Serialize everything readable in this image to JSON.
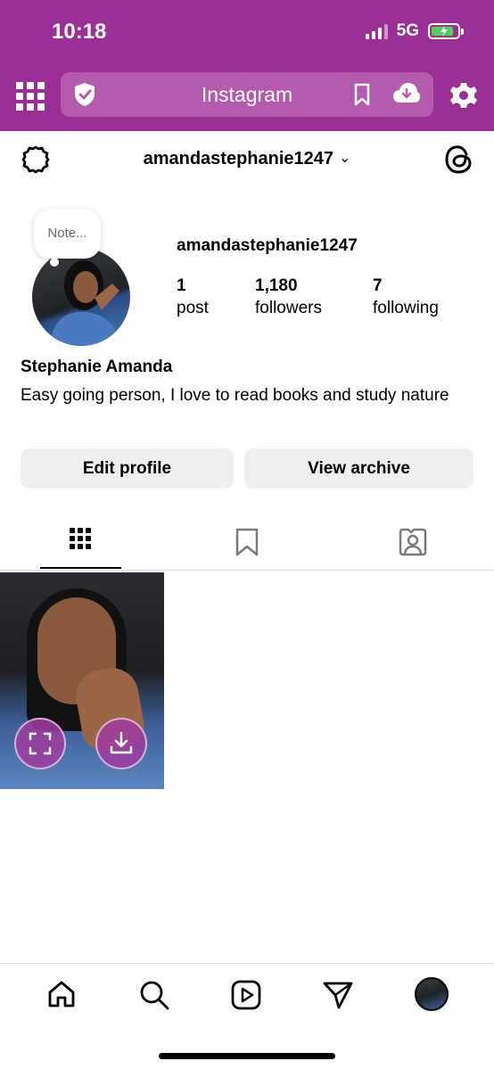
{
  "status_bar": {
    "time": "10:18",
    "network": "5G",
    "battery_charging": true,
    "icons": [
      "signal-icon",
      "battery-icon"
    ]
  },
  "browser_bar": {
    "title": "Instagram",
    "background_color": "#9b2f95",
    "icons": [
      "grid-menu-icon",
      "shield-icon",
      "bookmark-icon",
      "cloud-download-icon",
      "gear-icon"
    ]
  },
  "profile_header": {
    "username": "amandastephanie1247",
    "icons": [
      "settings-icon",
      "chevron-down-icon",
      "threads-icon"
    ]
  },
  "profile": {
    "note_placeholder": "Note...",
    "username": "amandastephanie1247",
    "stats": {
      "posts_count": "1",
      "posts_label": "post",
      "followers_count": "1,180",
      "followers_label": "followers",
      "following_count": "7",
      "following_label": "following"
    },
    "display_name": "Stephanie Amanda",
    "bio": "Easy going person, I love to read books and study nature",
    "buttons": {
      "edit_profile": "Edit profile",
      "view_archive": "View archive"
    }
  },
  "tabs": {
    "active": "posts",
    "items": [
      "grid-icon",
      "saved-icon",
      "tagged-icon"
    ]
  },
  "posts": [
    {
      "overlay_buttons": [
        "expand-icon",
        "download-icon"
      ],
      "overlay_color": "#a03ca0"
    }
  ],
  "bottom_nav": {
    "items": [
      "home-icon",
      "search-icon",
      "reels-icon",
      "messages-icon",
      "profile-avatar"
    ]
  }
}
